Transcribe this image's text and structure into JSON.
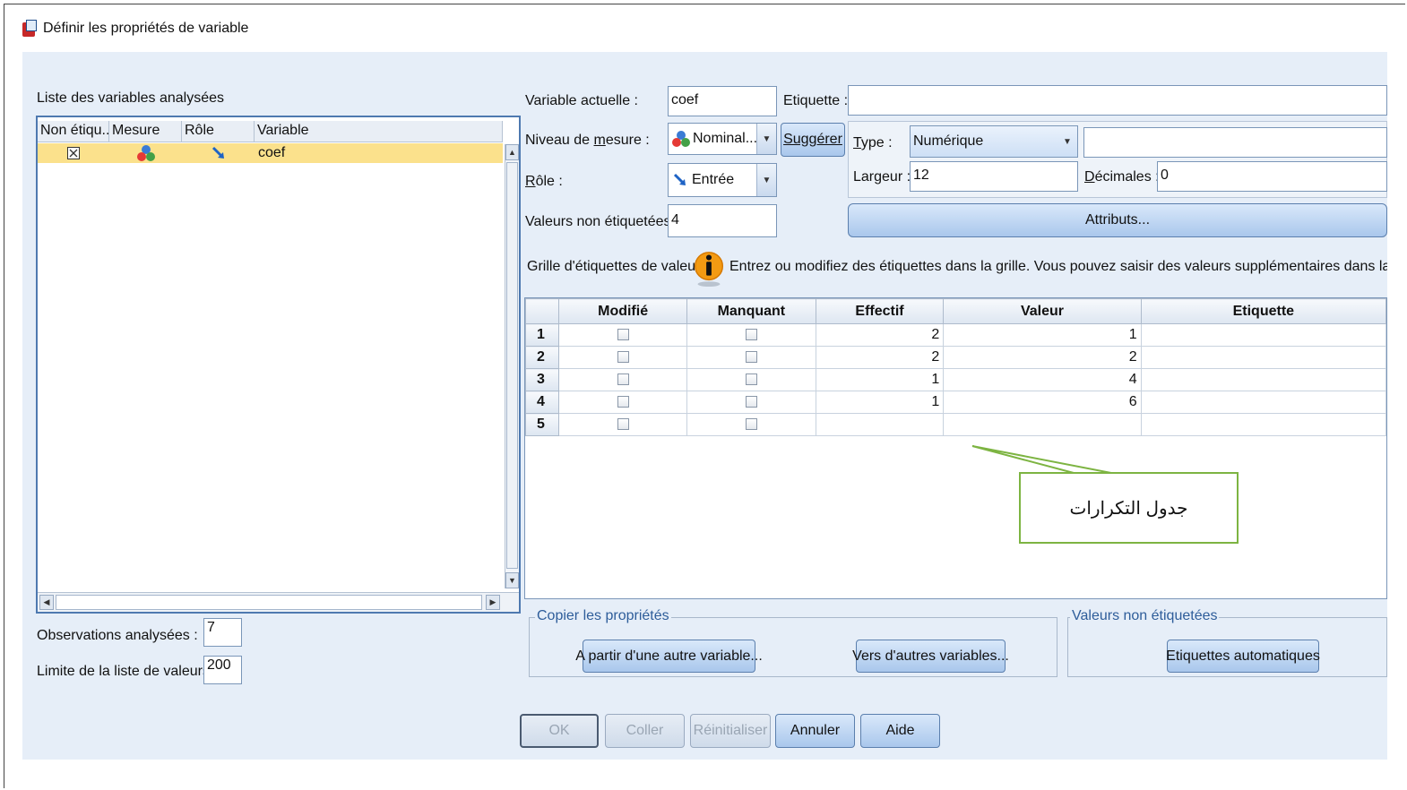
{
  "window": {
    "title": "Définir les propriétés de variable"
  },
  "left": {
    "list_title": "Liste des variables analysées",
    "columns": [
      "Non étiqu...",
      "Mesure",
      "Rôle",
      "Variable"
    ],
    "rows": [
      {
        "unlabeled_icon": "checkbox-x-icon",
        "measure_icon": "nominal-icon",
        "role_icon": "input-arrow-icon",
        "variable": "coef"
      }
    ],
    "observations_label": "Observations analysées :",
    "observations_value": "7",
    "limit_label": "Limite de la liste de valeurs :",
    "limit_value": "200"
  },
  "form": {
    "current_variable_label": "Variable actuelle :",
    "current_variable_value": "coef",
    "label_label": "Etiquette :",
    "label_value": "",
    "measure_label_pre": "Niveau de ",
    "measure_label_u": "m",
    "measure_label_post": "esure :",
    "measure_value": "Nominal...",
    "suggest_button": "Suggérer",
    "role_label_pre": "",
    "role_label_u": "R",
    "role_label_post": "ôle :",
    "role_value": "Entrée",
    "unlabeled_values_label": "Valeurs non étiquetées :",
    "unlabeled_values_value": "4",
    "type_label_u": "T",
    "type_label_post": "ype :",
    "type_value": "Numérique",
    "type_extra_value": "",
    "width_label": "Largeur :",
    "width_value": "12",
    "decimals_label_u": "D",
    "decimals_label_post": "écimales :",
    "decimals_value": "0",
    "attributes_button": "Attributs..."
  },
  "grid": {
    "label": "Grille d'étiquettes de valeur :",
    "info_text": "Entrez ou modifiez des étiquettes dans la grille. Vous pouvez saisir des valeurs supplémentaires dans la partie infér",
    "columns": [
      "Modifié",
      "Manquant",
      "Effectif",
      "Valeur",
      "Etiquette"
    ],
    "rows": [
      {
        "n": "1",
        "count": "2",
        "value": "1",
        "label": ""
      },
      {
        "n": "2",
        "count": "2",
        "value": "2",
        "label": ""
      },
      {
        "n": "3",
        "count": "1",
        "value": "4",
        "label": ""
      },
      {
        "n": "4",
        "count": "1",
        "value": "6",
        "label": ""
      },
      {
        "n": "5",
        "count": "",
        "value": "",
        "label": ""
      }
    ]
  },
  "annotation": {
    "text": "جدول التكرارات",
    "border_color": "#7db442"
  },
  "copy_group": {
    "title": "Copier les propriétés",
    "from_button": "A partir d'une autre variable...",
    "to_button": "Vers d'autres variables..."
  },
  "unlabeled_group": {
    "title": "Valeurs non étiquetées",
    "auto_button": "Etiquettes automatiques"
  },
  "footer": {
    "ok": "OK",
    "paste": "Coller",
    "reset": "Réinitialiser",
    "cancel": "Annuler",
    "help": "Aide"
  }
}
